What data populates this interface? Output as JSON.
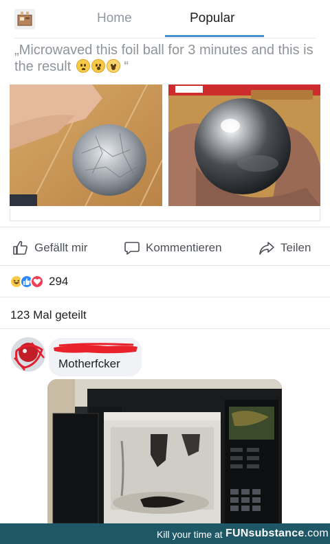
{
  "nav": {
    "tabs": [
      {
        "label": "Home",
        "active": false
      },
      {
        "label": "Popular",
        "active": true
      }
    ],
    "accent_color": "#4a8fd0"
  },
  "post": {
    "title": "„Microwaved this foil ball for 3 minutes and this is the result",
    "title_close": "“",
    "title_emojis": [
      "frowning-face-emoji",
      "astonished-face-emoji",
      "screaming-face-emoji"
    ],
    "images": [
      "crumpled-foil-ball-photo",
      "polished-metal-sphere-photo"
    ]
  },
  "actions": {
    "like": "Gefällt mir",
    "comment": "Kommentieren",
    "share": "Teilen"
  },
  "reactions": {
    "types": [
      "haha",
      "like",
      "love"
    ],
    "count": "294"
  },
  "shares": "123 Mal geteilt",
  "comment": {
    "author_redacted": true,
    "text": "Motherfcker",
    "image": "burnt-microwave-photo"
  },
  "footer": {
    "tagline": "Kill your time at",
    "brand_bold": "FUNsubstance",
    "brand_suffix": ".com",
    "background": "#1e5866"
  }
}
